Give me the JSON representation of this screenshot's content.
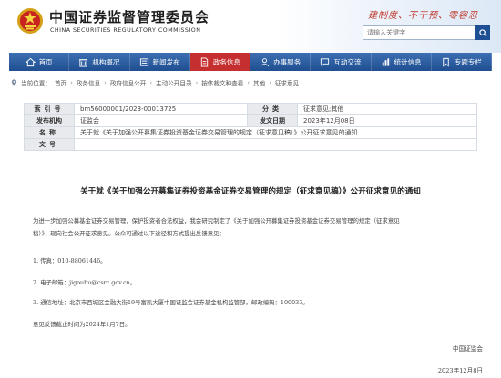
{
  "header": {
    "cn_title": "中国证券监督管理委员会",
    "en_title": "CHINA SECURITIES REGULATORY COMMISSION",
    "slogan": "建制度、不干预、零容忍",
    "search_placeholder": "请输入关键字"
  },
  "nav": {
    "items": [
      {
        "label": "首页",
        "icon": "home-icon",
        "active": false
      },
      {
        "label": "机构概况",
        "icon": "building-icon",
        "active": false
      },
      {
        "label": "新闻发布",
        "icon": "news-icon",
        "active": false
      },
      {
        "label": "政务信息",
        "icon": "document-icon",
        "active": true
      },
      {
        "label": "办事服务",
        "icon": "service-icon",
        "active": false
      },
      {
        "label": "互动交流",
        "icon": "chat-icon",
        "active": false
      },
      {
        "label": "统计信息",
        "icon": "stats-icon",
        "active": false
      },
      {
        "label": "专题专栏",
        "icon": "topic-icon",
        "active": false
      }
    ]
  },
  "breadcrumb": {
    "prefix": "当前位置：",
    "items": [
      "首页",
      "政务信息",
      "政府信息公开",
      "主动公开目录",
      "按体裁文种查看",
      "其他",
      "征求意见"
    ]
  },
  "meta": {
    "index_label": "索引号",
    "index_value": "bm56000001/2023-00013725",
    "category_label": "分类",
    "category_value": "征求意见;其他",
    "issuer_label": "发布机构",
    "issuer_value": "证监会",
    "date_label": "发文日期",
    "date_value": "2023年12月08日",
    "name_label": "名称",
    "name_value": "关于就《关于加强公开募集证券投资基金证券交易管理的规定（征求意见稿）》公开征求意见的通知",
    "docno_label": "文号",
    "docno_value": ""
  },
  "article": {
    "title": "关于就《关于加强公开募集证券投资基金证券交易管理的规定（征求意见稿）》公开征求意见的通知",
    "para1": "为进一步加强公募基金证券交易管理，保护投资者合法权益，我会研究制定了《关于加强公开募集证券投资基金证券交易管理的规定（征求意见",
    "para1b": "稿）》，现向社会公开征求意见。公众可通过以下途径和方式提出反馈意见：",
    "item1": "1. 传真：010-88061446。",
    "item2": "2. 电子邮箱：jigoubu@csrc.gov.cn。",
    "item3": "3. 通信地址：北京市西城区金融大街19号富凯大厦中国证监会证券基金机构监管部，邮政编码：100033。",
    "deadline": "意见反馈截止时间为2024年1月7日。",
    "signer": "中国证监会",
    "sign_date": "2023年12月8日"
  },
  "colors": {
    "nav_blue": "#1f4f91",
    "nav_active_red": "#c62f2f",
    "slogan_red": "#c0392b"
  }
}
